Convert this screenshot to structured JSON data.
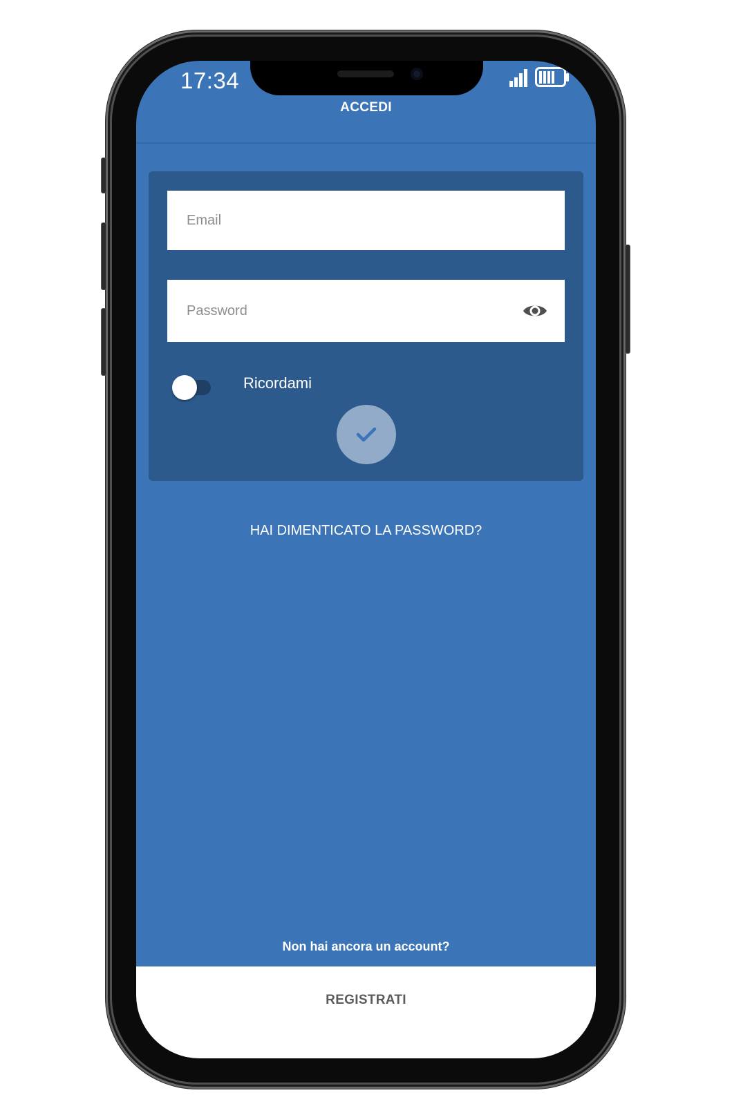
{
  "status_bar": {
    "time": "17:34",
    "signal_icon": "cellular-signal-icon",
    "battery_icon": "battery-icon"
  },
  "header": {
    "title": "ACCEDI"
  },
  "login_form": {
    "email": {
      "value": "",
      "placeholder": "Email"
    },
    "password": {
      "value": "",
      "placeholder": "Password",
      "visibility_icon": "eye-icon"
    },
    "remember_me": {
      "label": "Ricordami",
      "enabled": false
    },
    "submit_icon": "check-icon"
  },
  "links": {
    "forgot_password": "HAI DIMENTICATO LA PASSWORD?"
  },
  "footer": {
    "prompt": "Non hai ancora un account?",
    "register_label": "REGISTRATI"
  },
  "colors": {
    "background": "#3b74b7",
    "card": "#2c5a8c",
    "submit_button": "#91abc9",
    "accent_check": "#3b74b7"
  }
}
